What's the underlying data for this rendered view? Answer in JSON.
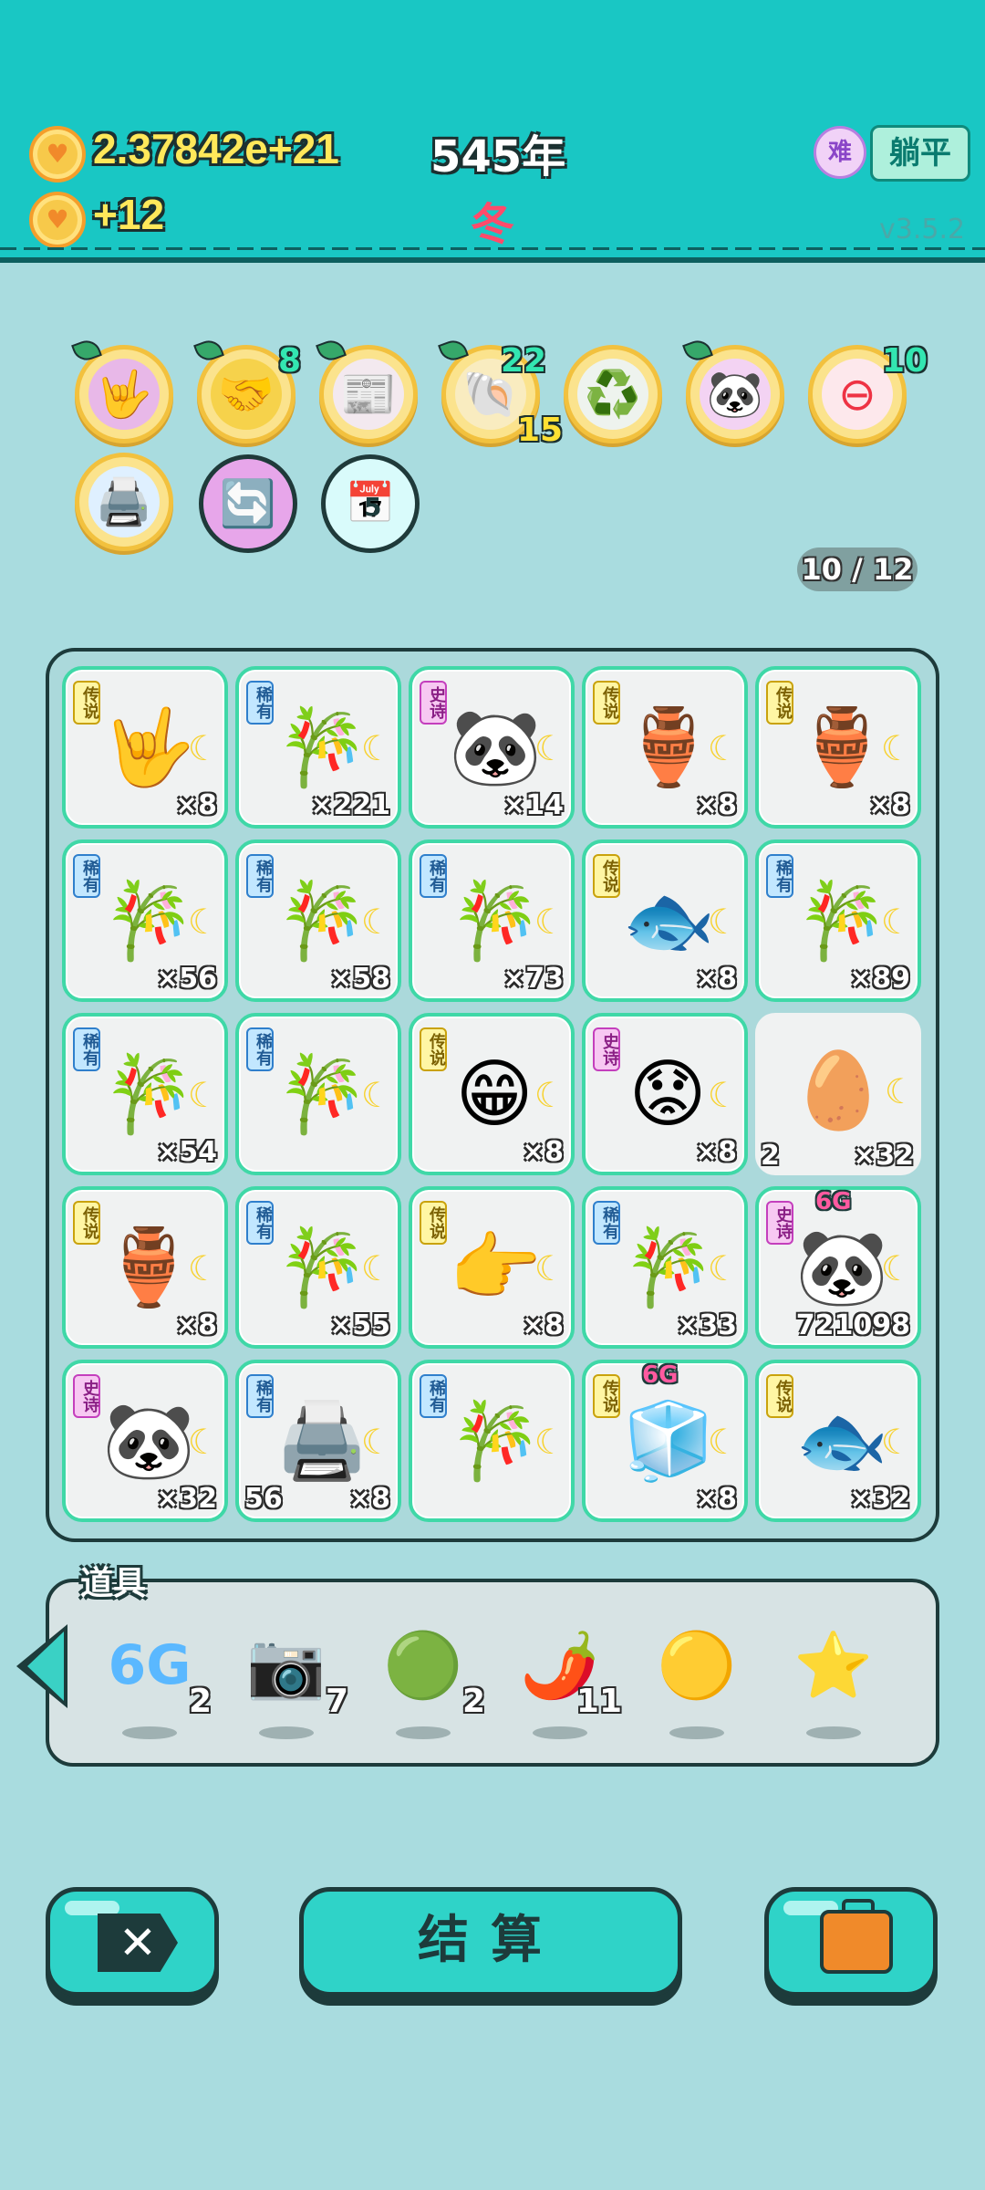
{
  "top": {
    "money": "2.37842e+21",
    "income": "+12",
    "year": "545年",
    "season": "冬",
    "difficulty_icon": "难",
    "mode": "躺平",
    "version": "v3.5.2",
    "coin_icon": "heart-coin-icon"
  },
  "relics": [
    {
      "icon": "🤟",
      "num": ""
    },
    {
      "icon": "🤝",
      "num": "8"
    },
    {
      "icon": "📰",
      "num": ""
    },
    {
      "icon": "🐚",
      "num": "22",
      "num2": "15"
    },
    {
      "icon": "♻️",
      "num": ""
    },
    {
      "icon": "🐼",
      "num": ""
    },
    {
      "icon": "⊖",
      "num": "10"
    },
    {
      "icon": "🖨️",
      "num": ""
    },
    {
      "icon": "🔄",
      "num": ""
    },
    {
      "icon": "📅",
      "num": "5"
    }
  ],
  "pager": "10 / 12",
  "cells": [
    {
      "tag": "传说",
      "type": "leg",
      "icon": "🤟",
      "count": "×8"
    },
    {
      "tag": "稀有",
      "type": "rare",
      "icon": "🎋",
      "count": "×221"
    },
    {
      "tag": "史诗",
      "type": "epic",
      "icon": "🐼",
      "count": "×14"
    },
    {
      "tag": "传说",
      "type": "leg",
      "icon": "🏺",
      "count": "×8"
    },
    {
      "tag": "传说",
      "type": "leg",
      "icon": "🏺",
      "count": "×8"
    },
    {
      "tag": "稀有",
      "type": "rare",
      "icon": "🎋",
      "count": "×56"
    },
    {
      "tag": "稀有",
      "type": "rare",
      "icon": "🎋",
      "count": "×58"
    },
    {
      "tag": "稀有",
      "type": "rare",
      "icon": "🎋",
      "count": "×73"
    },
    {
      "tag": "传说",
      "type": "leg",
      "icon": "🐟",
      "count": "×8"
    },
    {
      "tag": "稀有",
      "type": "rare",
      "icon": "🎋",
      "count": "×89"
    },
    {
      "tag": "稀有",
      "type": "rare",
      "icon": "🎋",
      "count": "×54"
    },
    {
      "tag": "稀有",
      "type": "rare",
      "icon": "🎋",
      "count": ""
    },
    {
      "tag": "传说",
      "type": "leg",
      "icon": "😁",
      "count": "×8"
    },
    {
      "tag": "史诗",
      "type": "epic",
      "icon": "😟",
      "count": "×8"
    },
    {
      "tag": "",
      "type": "",
      "icon": "🥚",
      "count": "×32",
      "left": "2"
    },
    {
      "tag": "传说",
      "type": "leg",
      "icon": "🏺",
      "count": "×8"
    },
    {
      "tag": "稀有",
      "type": "rare",
      "icon": "🎋",
      "count": "×55"
    },
    {
      "tag": "传说",
      "type": "leg",
      "icon": "👉",
      "count": "×8"
    },
    {
      "tag": "稀有",
      "type": "rare",
      "icon": "🎋",
      "count": "×33"
    },
    {
      "tag": "史诗",
      "type": "epic",
      "icon": "🐼",
      "count": "721098",
      "badge": "6G"
    },
    {
      "tag": "史诗",
      "type": "epic",
      "icon": "🐼",
      "count": "×32"
    },
    {
      "tag": "稀有",
      "type": "rare",
      "icon": "🖨️",
      "count": "×8",
      "left": "56"
    },
    {
      "tag": "稀有",
      "type": "rare",
      "icon": "🎋",
      "count": ""
    },
    {
      "tag": "传说",
      "type": "leg",
      "icon": "🧊",
      "count": "×8",
      "badge": "6G"
    },
    {
      "tag": "传说",
      "type": "leg",
      "icon": "🐟",
      "count": "×32"
    }
  ],
  "tools": {
    "title": "道具",
    "items": [
      {
        "icon": "6G",
        "count": "2"
      },
      {
        "icon": "📷",
        "count": "7"
      },
      {
        "icon": "🟢",
        "count": "2"
      },
      {
        "icon": "🌶️",
        "count": "11"
      },
      {
        "icon": "🟡",
        "count": ""
      },
      {
        "icon": "⭐",
        "count": ""
      }
    ]
  },
  "buttons": {
    "settle": "结算",
    "cancel": "✕",
    "bag": "briefcase-icon"
  }
}
